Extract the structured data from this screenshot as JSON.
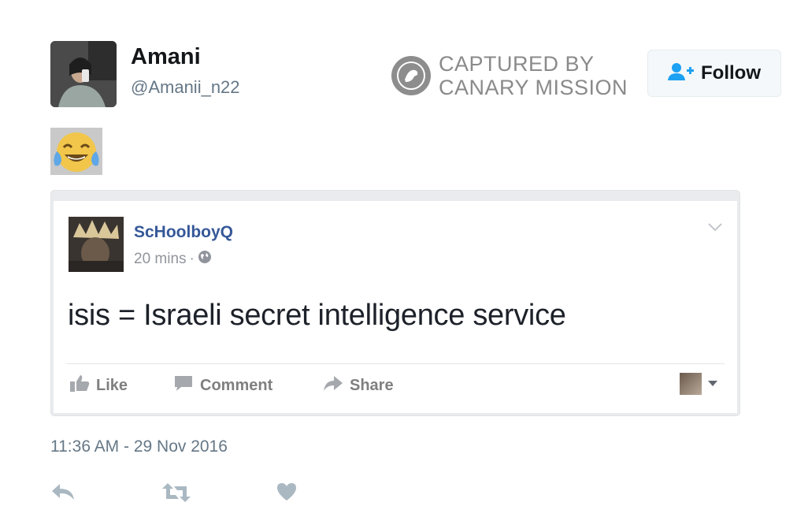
{
  "tweet": {
    "display_name": "Amani",
    "handle": "@Amanii_n22",
    "follow_label": "Follow",
    "body_emoji": "😂",
    "timestamp": "11:36 AM - 29 Nov 2016"
  },
  "watermark": {
    "line1": "CAPTURED BY",
    "line2": "CANARY MISSION"
  },
  "embedded_post": {
    "author": "ScHoolboyQ",
    "time": "20 mins",
    "separator": "·",
    "text": "isis = Israeli secret intelligence service",
    "actions": {
      "like": "Like",
      "comment": "Comment",
      "share": "Share"
    }
  },
  "colors": {
    "tweet_text": "#14171a",
    "muted": "#657786",
    "fb_link": "#365899",
    "fb_muted": "#90949c",
    "action_icon": "#aab8c2",
    "follow_icon": "#1da1f2"
  },
  "icons": {
    "follow": "add-user-icon",
    "watermark": "canary-bird-icon",
    "fb_privacy": "globe-icon",
    "fb_menu": "chevron-down-icon",
    "like": "thumbs-up-icon",
    "comment": "comment-bubble-icon",
    "share": "share-arrow-icon",
    "reply": "reply-icon",
    "retweet": "retweet-icon",
    "heart": "heart-icon"
  }
}
